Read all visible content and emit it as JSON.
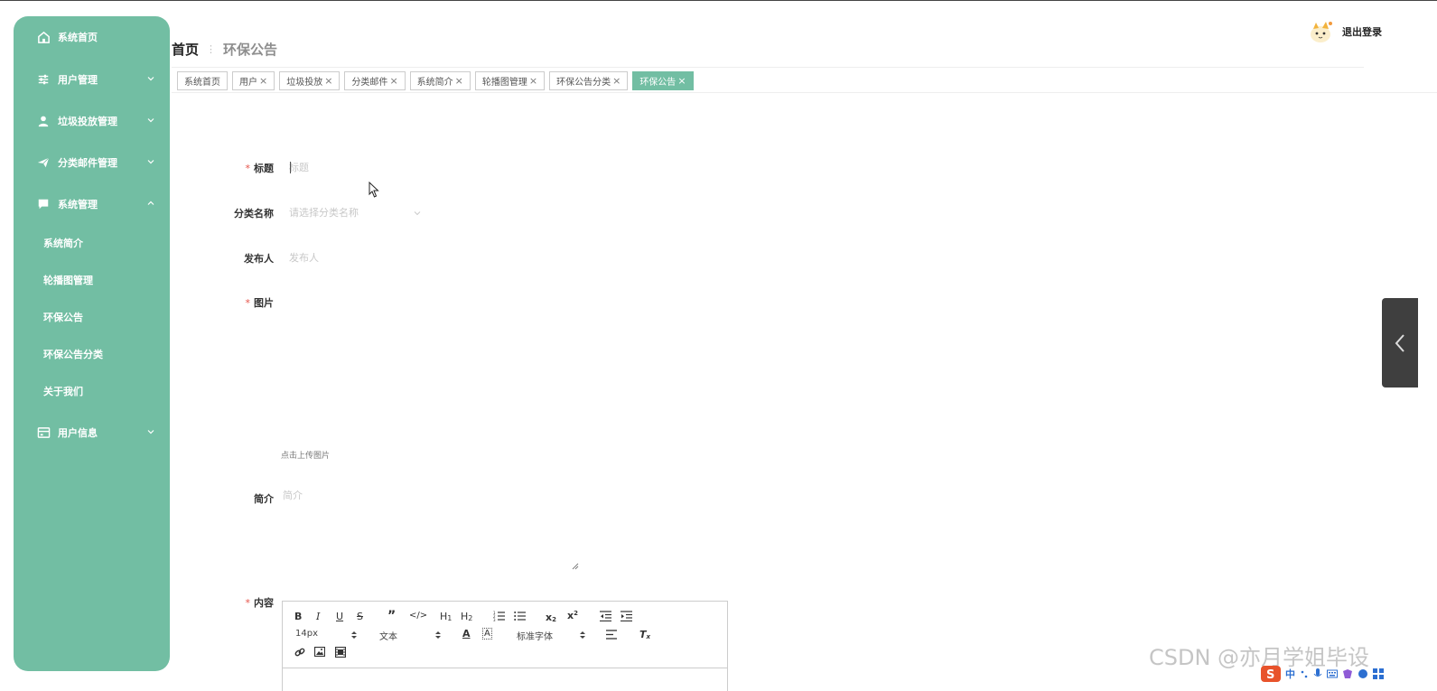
{
  "sidebar": {
    "items": [
      {
        "label": "系统首页",
        "icon": "home-icon"
      },
      {
        "label": "用户管理",
        "icon": "sliders-icon"
      },
      {
        "label": "垃圾投放管理",
        "icon": "user-icon"
      },
      {
        "label": "分类邮件管理",
        "icon": "paper-plane-icon"
      },
      {
        "label": "系统管理",
        "icon": "chat-icon"
      },
      {
        "label": "用户信息",
        "icon": "card-icon"
      }
    ],
    "system_sub_items": [
      "系统简介",
      "轮播图管理",
      "环保公告",
      "环保公告分类",
      "关于我们"
    ]
  },
  "header": {
    "breadcrumb_home": "首页",
    "breadcrumb_current": "环保公告",
    "logout_label": "退出登录"
  },
  "tabs": [
    {
      "label": "系统首页",
      "closable": false
    },
    {
      "label": "用户",
      "closable": true
    },
    {
      "label": "垃圾投放",
      "closable": true
    },
    {
      "label": "分类邮件",
      "closable": true
    },
    {
      "label": "系统简介",
      "closable": true
    },
    {
      "label": "轮播图管理",
      "closable": true
    },
    {
      "label": "环保公告分类",
      "closable": true
    },
    {
      "label": "环保公告",
      "closable": true,
      "active": true
    }
  ],
  "tab_close_glyph": "×",
  "form": {
    "title_label": "标题",
    "title_placeholder": "标题",
    "category_label": "分类名称",
    "category_placeholder": "请选择分类名称",
    "publisher_label": "发布人",
    "publisher_placeholder": "发布人",
    "image_label": "图片",
    "upload_hint": "点击上传图片",
    "intro_label": "简介",
    "intro_placeholder": "简介",
    "content_label": "内容",
    "required_mark": "*"
  },
  "editor": {
    "font_size": "14px",
    "header_select": "文本",
    "font_family": "标准字体"
  },
  "watermark": "CSDN @亦月学姐毕设",
  "tray_ime": "中",
  "colors": {
    "sidebar_bg": "#72bea3",
    "active_tab": "#72bea3",
    "required": "#e6534a"
  }
}
